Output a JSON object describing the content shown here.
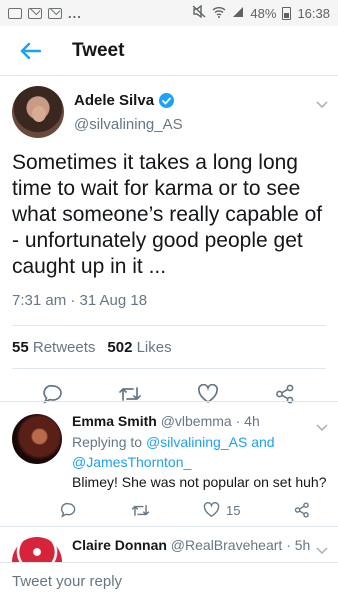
{
  "status_bar": {
    "left_icons": [
      "notification-icon",
      "mail-icon",
      "mail-icon"
    ],
    "overflow": "...",
    "battery_percent": "48%",
    "time": "16:38"
  },
  "header": {
    "title": "Tweet"
  },
  "tweet": {
    "author_name": "Adele Silva",
    "author_handle": "@silvalining_AS",
    "text": "Sometimes it takes a long long time to wait for karma or to see what someone’s really capable of - unfortunately good people get caught up in it ...",
    "timestamp": "7:31 am · 31 Aug 18",
    "retweet_count": "55",
    "retweet_label": "Retweets",
    "like_count": "502",
    "like_label": "Likes"
  },
  "replies": [
    {
      "name": "Emma Smith",
      "handle": "@vlbemma",
      "time": "· 4h",
      "replying_prefix": "Replying to",
      "replying_to_1": "@silvalining_AS",
      "and": "and",
      "replying_to_2": "@JamesThornton_",
      "text": "Blimey! She was not popular on set huh?",
      "like_count": "15"
    },
    {
      "name": "Claire Donnan",
      "handle": "@RealBraveheart",
      "time": "· 5h"
    }
  ],
  "compose": {
    "placeholder": "Tweet your reply"
  },
  "colors": {
    "accent": "#1da1f2",
    "secondary_text": "#657786",
    "divider": "#e1e8ed"
  }
}
